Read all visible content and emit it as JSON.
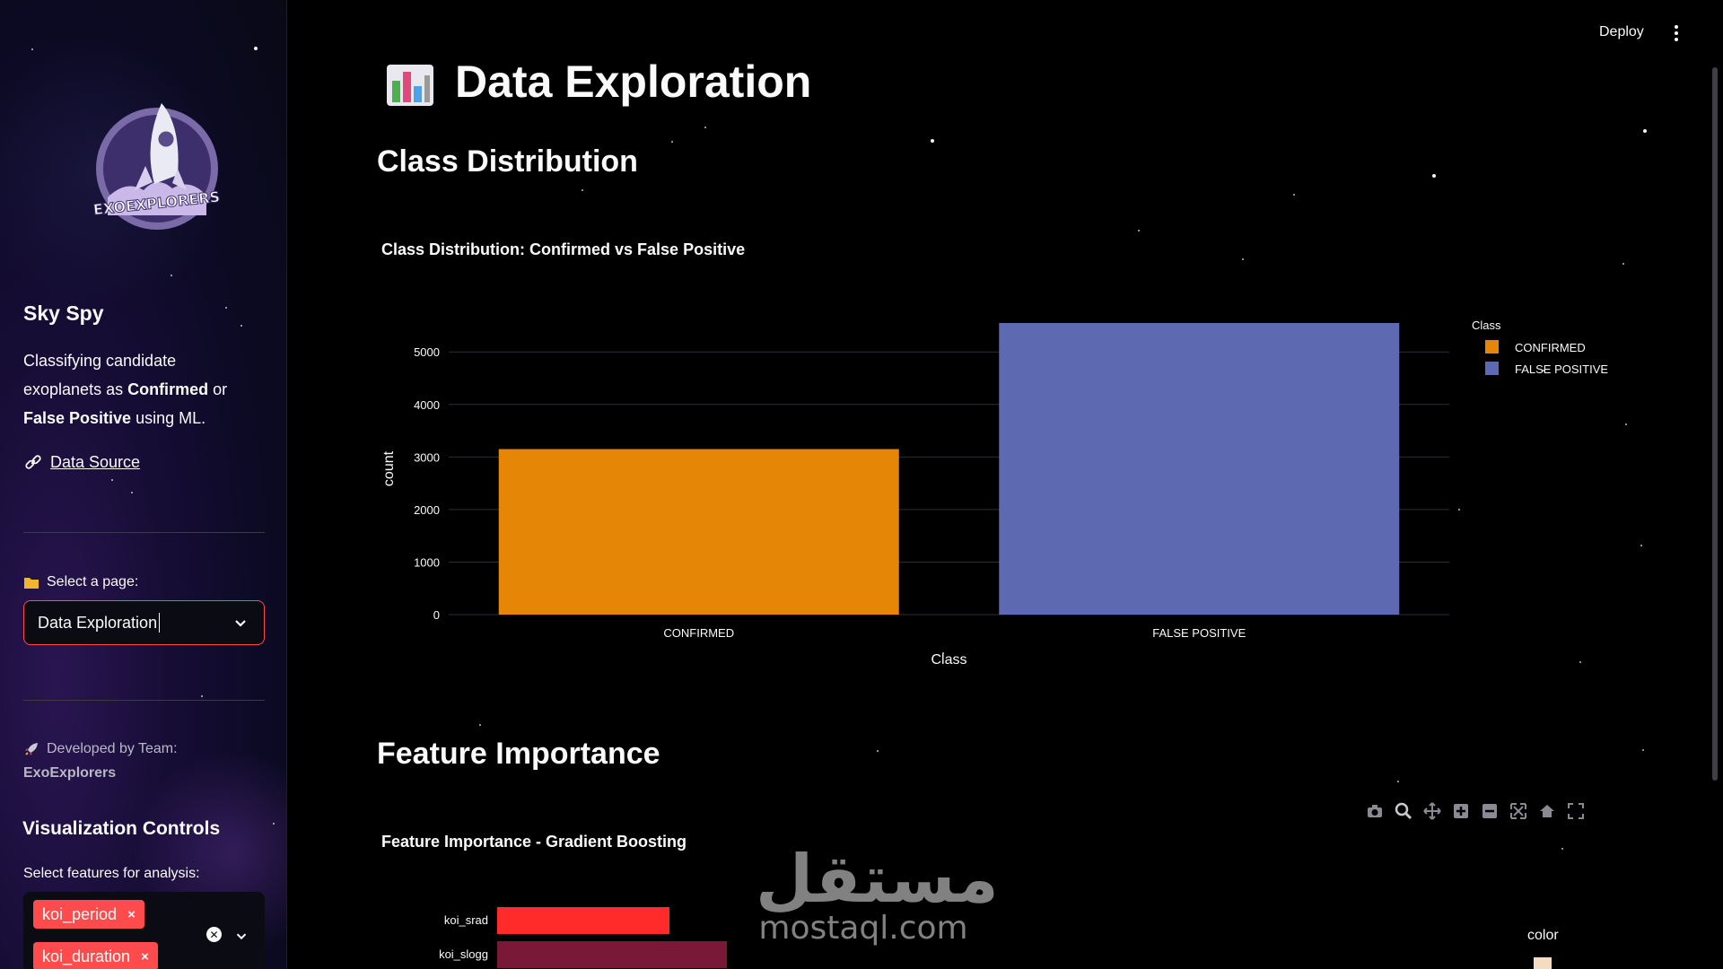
{
  "header": {
    "deploy_label": "Deploy"
  },
  "sidebar": {
    "logo_text": "EXOEXPLORERS",
    "title": "Sky Spy",
    "desc_part1": "Classifying candidate exoplanets as ",
    "desc_bold1": "Confirmed",
    "desc_part2": " or ",
    "desc_bold2": "False Positive",
    "desc_part3": " using ML.",
    "data_source_label": "Data Source",
    "select_label": "Select a page:",
    "select_value": "Data Exploration",
    "dev_label": "Developed by Team:",
    "dev_team": "ExoExplorers",
    "viz_title": "Visualization Controls",
    "features_label": "Select features for analysis:",
    "features": [
      "koi_period",
      "koi_duration"
    ]
  },
  "main": {
    "title": "Data Exploration",
    "section1": "Class Distribution",
    "section2": "Feature Importance",
    "chart2_title": "Feature Importance - Gradient Boosting",
    "chart2_legend_title": "color"
  },
  "colors": {
    "accent": "#ff4b4b",
    "confirmed": "#e58606",
    "false_positive": "#5d69b1",
    "bar_red": "#ff2b2b",
    "bar_maroon": "#7a1838"
  },
  "watermark": {
    "arabic": "مستقل",
    "latin": "mostaql.com"
  },
  "chart_data": [
    {
      "type": "bar",
      "title": "Class Distribution: Confirmed vs False Positive",
      "categories": [
        "CONFIRMED",
        "FALSE POSITIVE"
      ],
      "values": [
        3150,
        5550
      ],
      "xlabel": "Class",
      "ylabel": "count",
      "ylim": [
        0,
        5550
      ],
      "yticks": [
        0,
        1000,
        2000,
        3000,
        4000,
        5000
      ],
      "legend": {
        "title": "Class",
        "position": "top-right",
        "entries": [
          "CONFIRMED",
          "FALSE POSITIVE"
        ]
      },
      "grid": true
    },
    {
      "type": "bar",
      "orientation": "horizontal",
      "title": "Feature Importance - Gradient Boosting",
      "categories": [
        "koi_srad",
        "koi_slogg"
      ],
      "values": [
        0.06,
        0.08
      ],
      "legend": {
        "title": "color",
        "position": "right"
      }
    }
  ]
}
